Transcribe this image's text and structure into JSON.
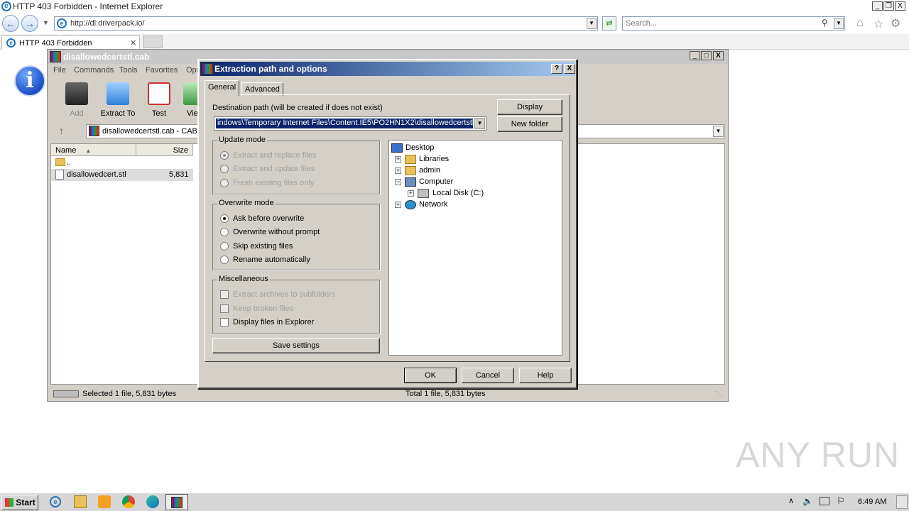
{
  "browser": {
    "window_title": "HTTP 403 Forbidden - Internet Explorer",
    "address": "http://dl.driverpack.io/",
    "search_placeholder": "Search...",
    "tab_label": "HTTP 403 Forbidden",
    "window_controls": [
      "_",
      "❐",
      "X"
    ]
  },
  "winrar": {
    "title": "disallowedcertstl.cab",
    "menu": [
      "File",
      "Commands",
      "Tools",
      "Favorites",
      "Opt"
    ],
    "toolbar": [
      "Add",
      "Extract To",
      "Test",
      "Vie"
    ],
    "path": "disallowedcertstl.cab - CAB",
    "columns": [
      "Name",
      "Size"
    ],
    "files": [
      {
        "name": "..",
        "size": ""
      },
      {
        "name": "disallowedcert.stl",
        "size": "5,831"
      }
    ],
    "status_left": "Selected 1 file, 5,831 bytes",
    "status_right": "Total 1 file, 5,831 bytes"
  },
  "dialog": {
    "title": "Extraction path and options",
    "help_btn": "?",
    "close_btn": "X",
    "tabs": [
      "General",
      "Advanced"
    ],
    "dest_label": "Destination path (will be created if does not exist)",
    "dest_value": "indows\\Temporary Internet Files\\Content.IE5\\PO2HN1X2\\disallowedcertstl",
    "display_btn": "Display",
    "new_folder_btn": "New folder",
    "update_mode": {
      "title": "Update mode",
      "options": [
        "Extract and replace files",
        "Extract and update files",
        "Fresh existing files only"
      ]
    },
    "overwrite_mode": {
      "title": "Overwrite mode",
      "options": [
        "Ask before overwrite",
        "Overwrite without prompt",
        "Skip existing files",
        "Rename automatically"
      ]
    },
    "misc": {
      "title": "Miscellaneous",
      "options": [
        "Extract archives to subfolders",
        "Keep broken files",
        "Display files in Explorer"
      ]
    },
    "save_btn": "Save settings",
    "tree": [
      "Desktop",
      "Libraries",
      "admin",
      "Computer",
      "Local Disk (C:)",
      "Network"
    ],
    "ok": "OK",
    "cancel": "Cancel",
    "help": "Help"
  },
  "taskbar": {
    "start": "Start",
    "clock": "6:49 AM"
  },
  "watermark": "ANY RUN"
}
